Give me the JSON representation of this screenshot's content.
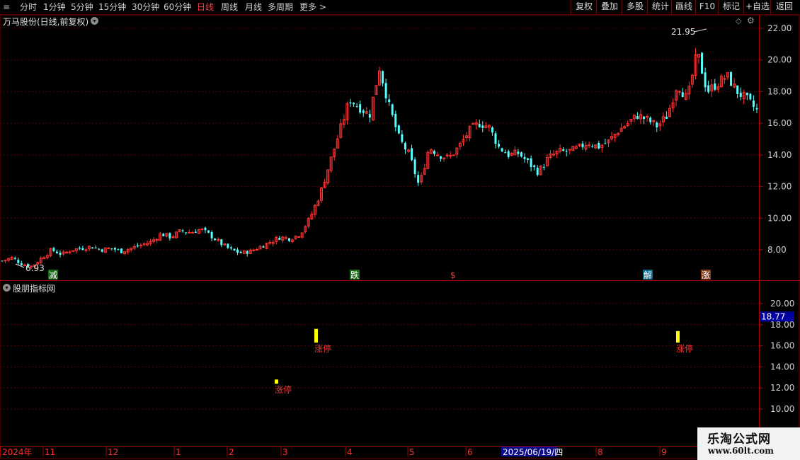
{
  "toolbar": {
    "periods": [
      "分时",
      "1分钟",
      "5分钟",
      "15分钟",
      "30分钟",
      "60分钟",
      "日线",
      "周线",
      "月线",
      "多周期",
      "更多"
    ],
    "active_period": "日线",
    "more_arrow": ">",
    "right_buttons": [
      "复权",
      "叠加",
      "多股",
      "统计",
      "画线",
      "F10",
      "标记",
      "+自选",
      "返回"
    ]
  },
  "main_panel": {
    "title": "万马股份(日线,前复权)",
    "price_axis": [
      "22.00",
      "20.00",
      "18.00",
      "16.00",
      "14.00",
      "12.00",
      "10.00",
      "8.00"
    ],
    "high_label": "21.95",
    "low_label": "6.93",
    "signals": [
      "减",
      "跌",
      "$",
      "解",
      "涨"
    ]
  },
  "sub_panel": {
    "title": "股朋指标网",
    "axis": [
      "20.00",
      "18.00",
      "16.00",
      "14.00",
      "12.00",
      "10.00"
    ],
    "current_value": "18.77",
    "limit_up_label": "涨停"
  },
  "time_axis": {
    "labels": [
      "2024年",
      "11",
      "12",
      "1",
      "2",
      "3",
      "4",
      "5",
      "6",
      "8",
      "9"
    ],
    "cursor_date": "2025/06/19/四"
  },
  "watermark": {
    "line1": "乐淘公式网",
    "line2": "www.60lt.com"
  },
  "colors": {
    "up": "#ff3333",
    "down": "#54ffff",
    "active_period": "#ff3a3a",
    "limit_bar": "#ffff00",
    "value_box": "#0000a0"
  },
  "chart_data": {
    "type": "candlestick",
    "y_range": [
      6.5,
      22.5
    ],
    "anchor_prices": [
      7.3,
      7.5,
      7.1,
      6.95,
      7.5,
      8.0,
      7.7,
      8.0,
      8.1,
      8.2,
      8.0,
      8.1,
      7.9,
      8.1,
      8.3,
      8.5,
      9.0,
      8.8,
      9.2,
      9.1,
      9.3,
      8.9,
      8.4,
      8.0,
      7.8,
      7.9,
      8.2,
      8.5,
      8.8,
      8.7,
      9.0,
      10.0,
      11.5,
      13.5,
      15.5,
      17.5,
      17.0,
      16.5,
      19.5,
      17.0,
      15.0,
      14.0,
      12.0,
      14.5,
      14.0,
      13.8,
      14.5,
      15.5,
      16.0,
      15.8,
      14.5,
      14.0,
      14.1,
      13.5,
      12.9,
      13.8,
      14.2,
      14.2,
      14.4,
      14.8,
      14.5,
      14.8,
      15.5,
      16.0,
      16.5,
      16.2,
      15.8,
      16.5,
      18.5,
      17.5,
      20.5,
      18.0,
      18.5,
      19.0,
      18.0,
      17.5,
      16.8
    ],
    "limit_up_bars": [
      {
        "price_from": 12.4,
        "price_to": 12.8
      },
      {
        "price_from": 16.3,
        "price_to": 17.6
      },
      {
        "price_from": 16.3,
        "price_to": 17.4
      }
    ],
    "sub_range": [
      9.0,
      21.0
    ]
  }
}
